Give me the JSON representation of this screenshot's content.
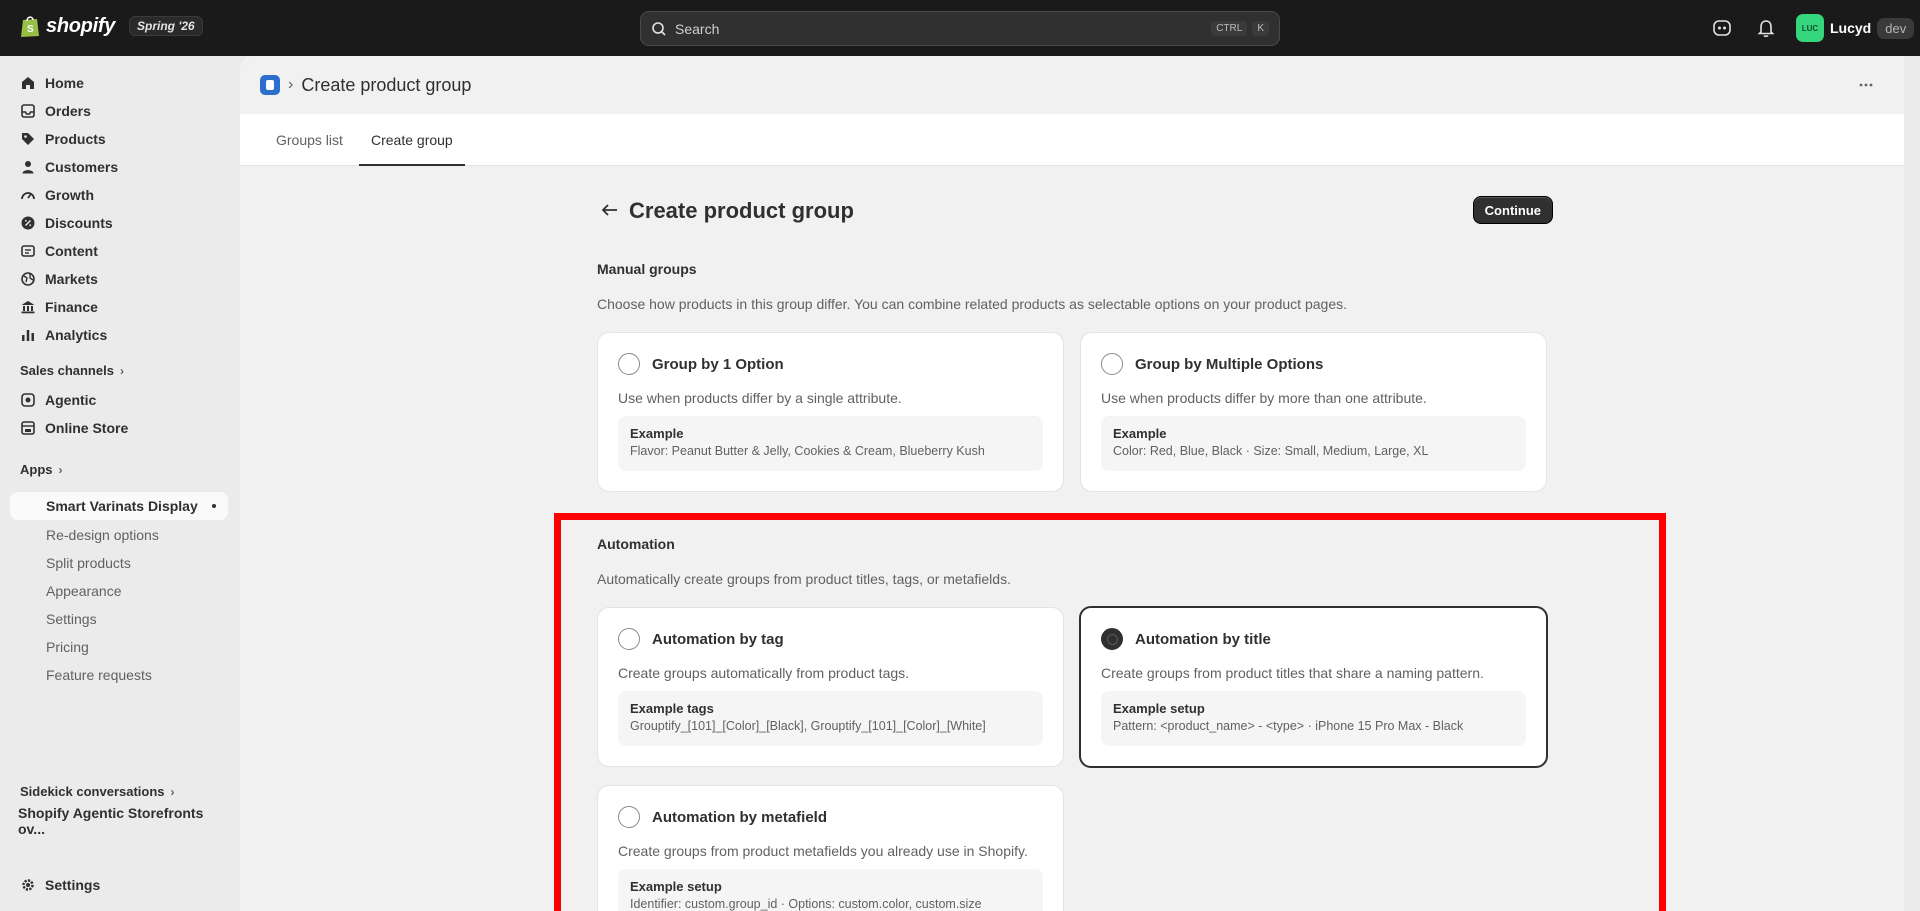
{
  "topbar": {
    "brand": "shopify",
    "edition": "Spring '26",
    "search_placeholder": "Search",
    "shortcut_keys": [
      "CTRL",
      "K"
    ],
    "user_initials": "LUC",
    "user_name": "Lucyd",
    "user_badge": "dev"
  },
  "sidebar": {
    "items": [
      {
        "label": "Home",
        "icon": "home-icon"
      },
      {
        "label": "Orders",
        "icon": "inbox-icon"
      },
      {
        "label": "Products",
        "icon": "tag-icon"
      },
      {
        "label": "Customers",
        "icon": "person-icon"
      },
      {
        "label": "Growth",
        "icon": "gauge-icon"
      },
      {
        "label": "Discounts",
        "icon": "discount-icon"
      },
      {
        "label": "Content",
        "icon": "content-icon"
      },
      {
        "label": "Markets",
        "icon": "globe-icon"
      },
      {
        "label": "Finance",
        "icon": "bank-icon"
      },
      {
        "label": "Analytics",
        "icon": "bar-chart-icon"
      }
    ],
    "sales_channels_label": "Sales channels",
    "channels": [
      {
        "label": "Agentic",
        "icon": "agentic-icon"
      },
      {
        "label": "Online Store",
        "icon": "store-icon"
      }
    ],
    "apps_label": "Apps",
    "app_name": "Smart Varinats Display",
    "app_pages": [
      "Re-design options",
      "Split products",
      "Appearance",
      "Settings",
      "Pricing",
      "Feature requests"
    ],
    "sidekick_label": "Sidekick conversations",
    "sidekick_item": "Shopify Agentic Storefronts ov...",
    "settings_label": "Settings"
  },
  "header": {
    "title": "Create product group"
  },
  "tabs": [
    "Groups list",
    "Create group"
  ],
  "page": {
    "title": "Create product group",
    "continue_label": "Continue"
  },
  "manual": {
    "title": "Manual groups",
    "description": "Choose how products in this group differ. You can combine related products as selectable options on your product pages.",
    "cards": [
      {
        "title": "Group by 1 Option",
        "description": "Use when products differ by a single attribute.",
        "example_label": "Example",
        "example_text": "Flavor: Peanut Butter & Jelly, Cookies & Cream, Blueberry Kush",
        "selected": false
      },
      {
        "title": "Group by Multiple Options",
        "description": "Use when products differ by more than one attribute.",
        "example_label": "Example",
        "example_text": "Color: Red, Blue, Black · Size: Small, Medium, Large, XL",
        "selected": false
      }
    ]
  },
  "automation": {
    "title": "Automation",
    "description": "Automatically create groups from product titles, tags, or metafields.",
    "cards": [
      {
        "title": "Automation by tag",
        "description": "Create groups automatically from product tags.",
        "example_label": "Example tags",
        "example_text": "Grouptify_[101]_[Color]_[Black], Grouptify_[101]_[Color]_[White]",
        "selected": false
      },
      {
        "title": "Automation by title",
        "description": "Create groups from product titles that share a naming pattern.",
        "example_label": "Example setup",
        "example_text": "Pattern: <product_name> - <type> · iPhone 15 Pro Max - Black",
        "selected": true
      },
      {
        "title": "Automation by metafield",
        "description": "Create groups from product metafields you already use in Shopify.",
        "example_label": "Example setup",
        "example_text": "Identifier: custom.group_id · Options: custom.color, custom.size",
        "selected": false
      }
    ]
  },
  "colors": {
    "topbar": "#1a1a1a",
    "highlight": "#ff0000",
    "primary_button": "#303030",
    "avatar": "#36d67c"
  }
}
